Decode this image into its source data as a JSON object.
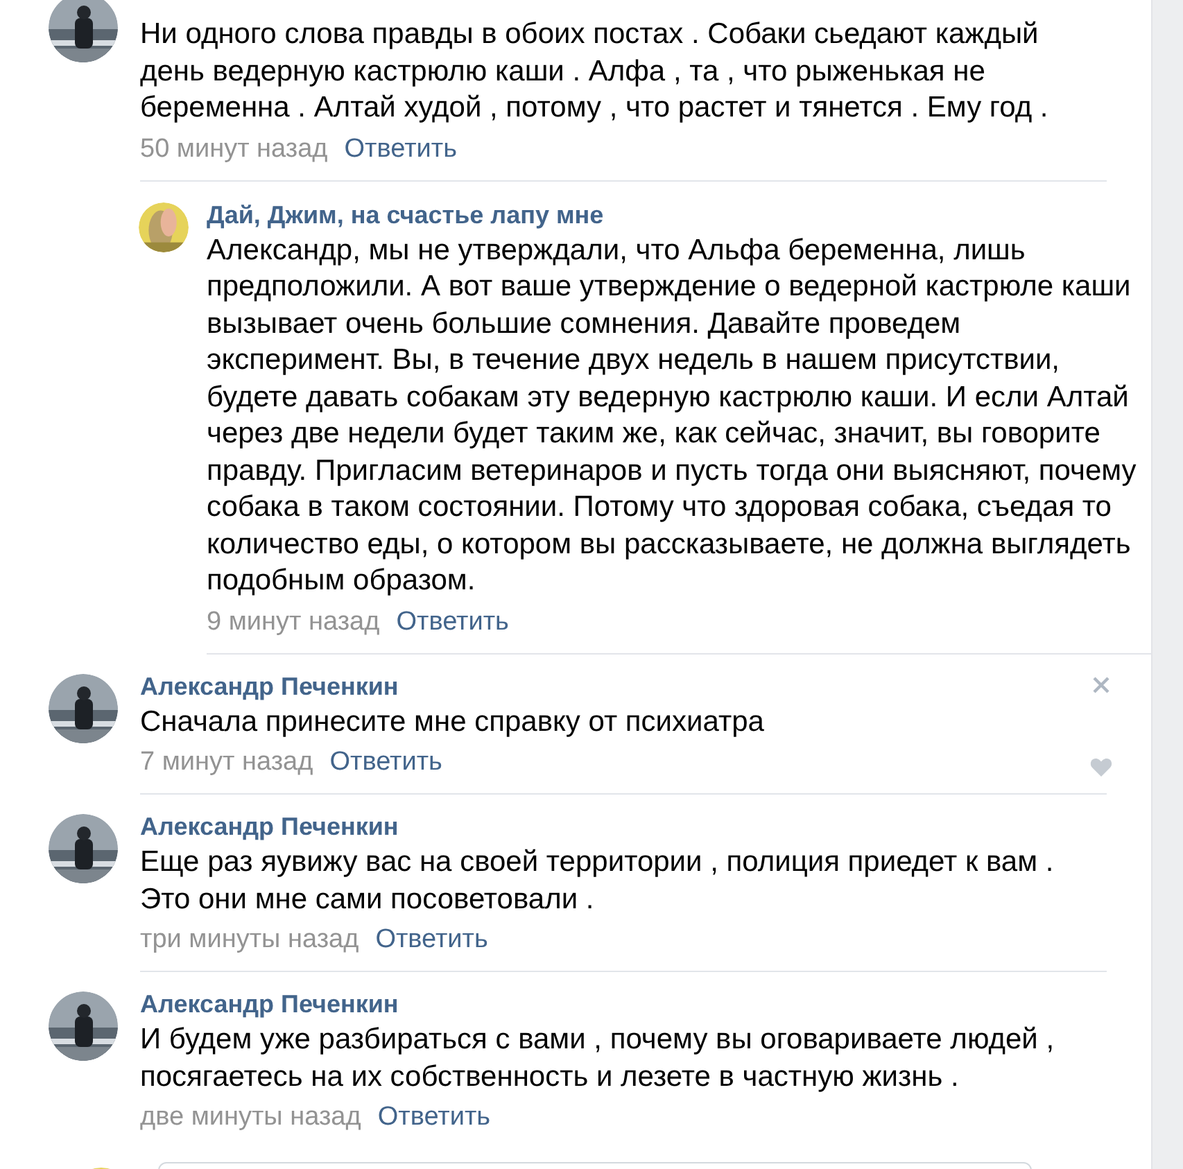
{
  "comments": [
    {
      "kind": "comment",
      "text": "Ни одного слова правды в обоих постах . Собаки сьедают каждый день ведерную кастрюлю каши . Алфа , та , что рыженькая не беременна . Алтай худой , потому , что растет и тянется . Ему год .",
      "time": "50 минут назад",
      "reply": "Ответить",
      "hovered": false
    },
    {
      "kind": "reply",
      "author": "Дай, Джим, на счастье лапу мне",
      "text": "Александр, мы не утверждали, что Альфа беременна, лишь предположили. А вот ваше утверждение о ведерной кастрюле каши вызывает очень большие сомнения. Давайте проведем эксперимент. Вы, в течение двух недель в нашем присутствии, будете давать собакам эту ведерную кастрюлю каши. И если Алтай через две недели будет таким же, как сейчас, значит, вы говорите правду. Пригласим ветеринаров и пусть тогда они выясняют, почему собака в таком состоянии. Потому что здоровая собака, съедая то количество еды, о котором вы рассказываете, не должна выглядеть подобным образом.",
      "time": "9 минут назад",
      "reply": "Ответить",
      "hovered": false
    },
    {
      "kind": "comment",
      "author": "Александр Печенкин",
      "text": "Сначала принесите мне справку от психиатра",
      "time": "7 минут назад",
      "reply": "Ответить",
      "hovered": true
    },
    {
      "kind": "comment",
      "author": "Александр Печенкин",
      "text": "Еще раз яувижу вас на своей территории , полиция приедет к вам . Это они мне сами посоветовали .",
      "time": "три минуты назад",
      "reply": "Ответить",
      "hovered": false
    },
    {
      "kind": "comment",
      "author": "Александр Печенкин",
      "text": "И будем уже разбираться с вами , почему вы оговариваете людей , посягаетесь на их собственность и лезете в частную жизнь .",
      "time": "две минуты назад",
      "reply": "Ответить",
      "hovered": false
    }
  ]
}
